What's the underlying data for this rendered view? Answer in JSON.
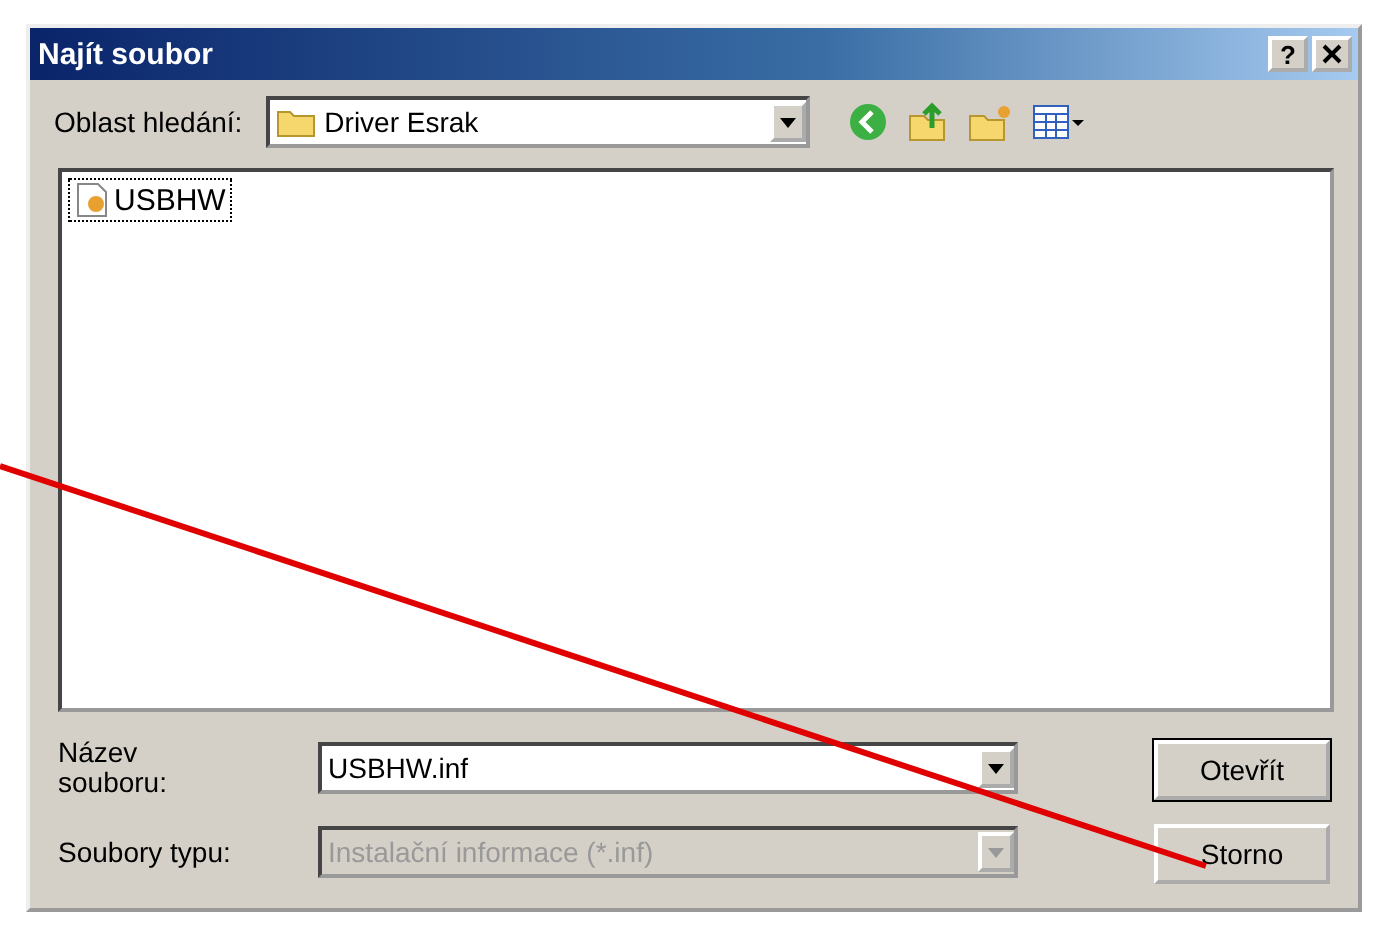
{
  "window": {
    "title": "Najít soubor",
    "help": "?"
  },
  "look_in": {
    "label": "Oblast hledání:",
    "value": "Driver Esrak"
  },
  "files": [
    {
      "name": "USBHW",
      "selected": true
    }
  ],
  "filename": {
    "label": "Název souboru:",
    "value": "USBHW.inf"
  },
  "filetype": {
    "label": "Soubory typu:",
    "value": "Instalační informace (*.inf)",
    "disabled": true
  },
  "buttons": [
    "Otevřít",
    "Storno"
  ]
}
